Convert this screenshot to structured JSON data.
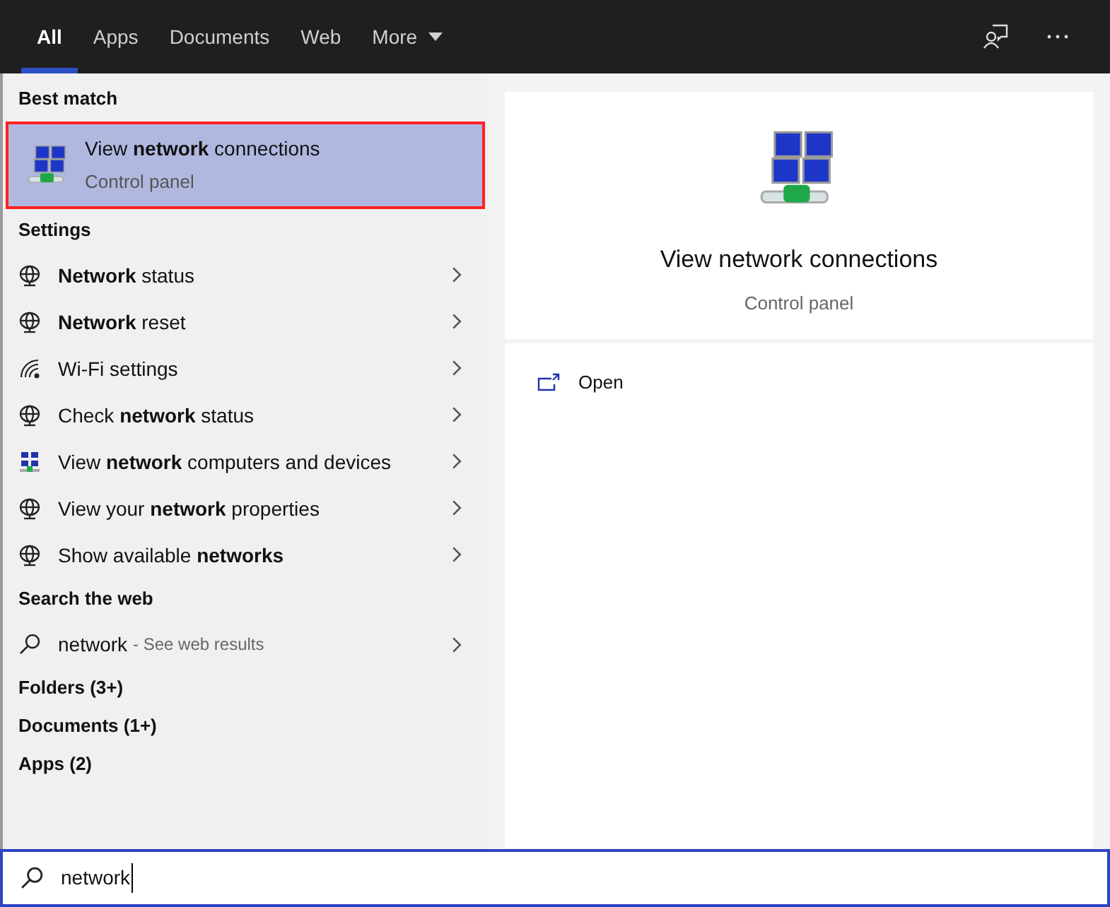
{
  "tabs": [
    {
      "label": "All",
      "selected": true
    },
    {
      "label": "Apps",
      "selected": false
    },
    {
      "label": "Documents",
      "selected": false
    },
    {
      "label": "Web",
      "selected": false
    },
    {
      "label": "More",
      "selected": false,
      "dropdown": true
    }
  ],
  "best_match": {
    "heading": "Best match",
    "title": "View **network** connections",
    "subtitle": "Control panel",
    "selected": true
  },
  "settings": {
    "heading": "Settings",
    "items": [
      {
        "kind": "globe",
        "label": "**Network** status"
      },
      {
        "kind": "globe",
        "label": "**Network** reset"
      },
      {
        "kind": "wifi",
        "label": "Wi-Fi settings"
      },
      {
        "kind": "globe",
        "label": "Check **network** status"
      },
      {
        "kind": "network",
        "label": "View **network** computers and devices"
      },
      {
        "kind": "globe",
        "label": "View your **network** properties"
      },
      {
        "kind": "globe",
        "label": "Show available **networks**"
      }
    ]
  },
  "web": {
    "heading": "Search the web",
    "query": "network",
    "hint": "- See web results"
  },
  "groups": [
    "Folders (3+)",
    "Documents (1+)",
    "Apps (2)"
  ],
  "preview": {
    "title": "View network connections",
    "subtitle": "Control panel",
    "actions": [
      "Open"
    ]
  },
  "search": {
    "value": "network"
  }
}
